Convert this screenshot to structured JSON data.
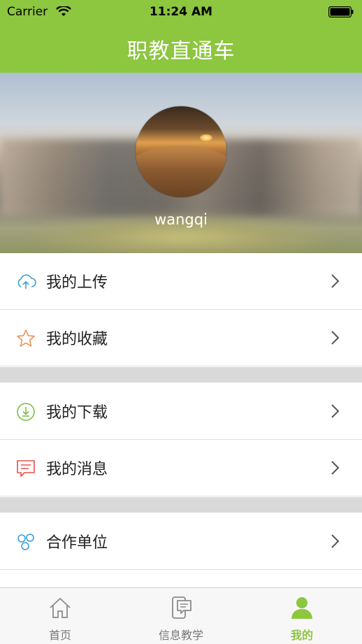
{
  "status_bar": {
    "carrier": "Carrier",
    "time": "11:24 AM"
  },
  "header": {
    "title": "职教直通车"
  },
  "profile": {
    "username": "wangqi"
  },
  "menu": {
    "items": [
      {
        "label": "我的上传",
        "icon": "cloud-upload-icon"
      },
      {
        "label": "我的收藏",
        "icon": "star-icon"
      },
      {
        "label": "我的下载",
        "icon": "download-icon"
      },
      {
        "label": "我的消息",
        "icon": "message-icon"
      },
      {
        "label": "合作单位",
        "icon": "partners-icon"
      }
    ]
  },
  "tabbar": {
    "tabs": [
      {
        "label": "首页",
        "icon": "home-icon",
        "active": false
      },
      {
        "label": "信息教学",
        "icon": "info-teaching-icon",
        "active": false
      },
      {
        "label": "我的",
        "icon": "person-icon",
        "active": true
      }
    ]
  },
  "colors": {
    "accent": "#8dc63f",
    "upload": "#3aa0d8",
    "star": "#f08a4b",
    "download": "#7bc043",
    "message": "#e8504a",
    "partners": "#3aa0d8"
  }
}
